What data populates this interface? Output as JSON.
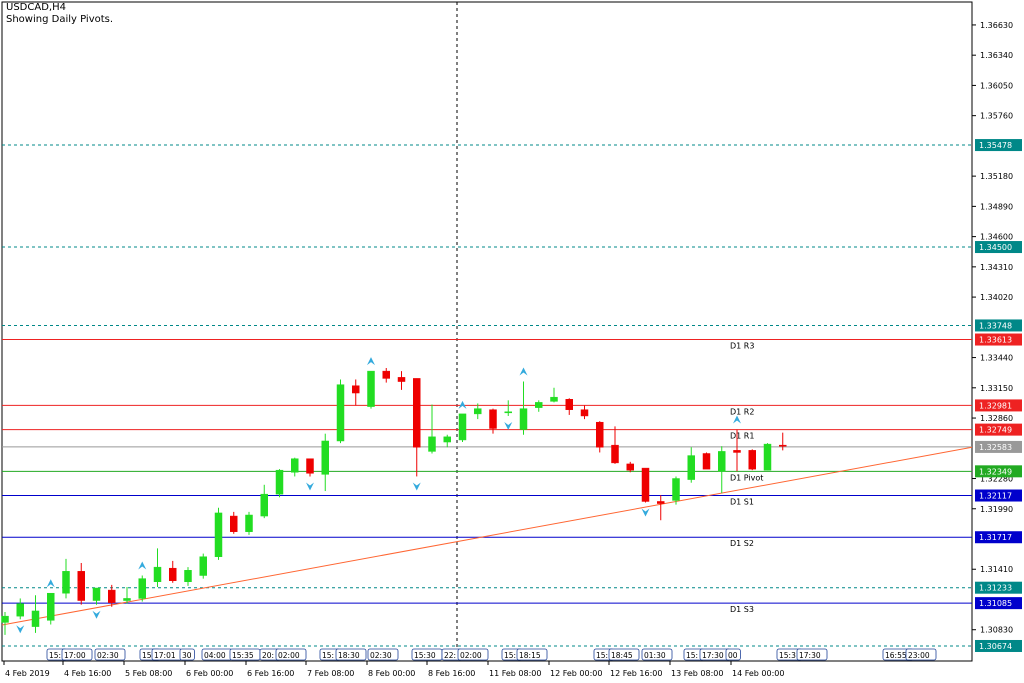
{
  "window": {
    "symbol_timeframe": "USDCAD,H4",
    "indicator_note": "Showing Daily Pivots."
  },
  "colors": {
    "bull": "#22dd22",
    "bear": "#ee0000",
    "resistance": "#ee2222",
    "support": "#0000cc",
    "pivot": "#22aa22",
    "trendline": "#ff6633",
    "dotted_level": "#008888",
    "price_tag": "#999999",
    "arrow": "#33aadd",
    "axis": "#000000"
  },
  "chart_data": {
    "type": "candlestick",
    "ylim": [
      1.3053,
      1.3685
    ],
    "price_ticks": [
      1.3663,
      1.3634,
      1.3605,
      1.3576,
      1.3518,
      1.3489,
      1.346,
      1.3431,
      1.3402,
      1.3344,
      1.3315,
      1.3286,
      1.3228,
      1.3199,
      1.3141,
      1.3083
    ],
    "levels": [
      {
        "name": "D1 R3",
        "price": 1.33613,
        "kind": "resistance",
        "tag": "1.33613"
      },
      {
        "name": "D1 R2",
        "price": 1.32981,
        "kind": "resistance",
        "tag": "1.32981"
      },
      {
        "name": "D1 R1",
        "price": 1.32749,
        "kind": "resistance",
        "tag": "1.32749"
      },
      {
        "name": "D1 Pivot",
        "price": 1.32349,
        "kind": "pivot",
        "tag": "1.32349"
      },
      {
        "name": "D1 S1",
        "price": 1.32117,
        "kind": "support",
        "tag": "1.32117"
      },
      {
        "name": "D1 S2",
        "price": 1.31717,
        "kind": "support",
        "tag": "1.31717"
      },
      {
        "name": "D1 S3",
        "price": 1.31085,
        "kind": "support",
        "tag": "1.31085"
      }
    ],
    "dotted_levels": [
      {
        "price": 1.35478,
        "tag": "1.35478"
      },
      {
        "price": 1.345,
        "tag": "1.34500"
      },
      {
        "price": 1.33748,
        "tag": "1.33748"
      },
      {
        "price": 1.31233,
        "tag": "1.31233"
      },
      {
        "price": 1.30674,
        "tag": "1.30674"
      }
    ],
    "current_price": {
      "price": 1.32583,
      "tag": "1.32583"
    },
    "time_labels": [
      "4 Feb 2019",
      "4 Feb 16:00",
      "5 Feb 08:00",
      "6 Feb 00:00",
      "6 Feb 16:00",
      "7 Feb 08:00",
      "8 Feb 00:00",
      "8 Feb 16:00",
      "11 Feb 08:00",
      "12 Feb 00:00",
      "12 Feb 16:00",
      "13 Feb 08:00",
      "14 Feb 00:00"
    ],
    "session_tags": [
      "15:",
      "17:00",
      "02:30",
      "15:",
      "17:01",
      "30",
      "04:00",
      "15:35",
      "20:",
      "02:00",
      "15:",
      "18:30",
      "02:30",
      "15:30",
      "22:",
      "02:00",
      "15:",
      "18:15",
      "15:",
      "18:45",
      "01:30",
      "15:",
      "17:30",
      "00",
      "15:3",
      "17:30",
      "16:55",
      "23:00"
    ],
    "candles": [
      {
        "o": 1.309,
        "h": 1.31,
        "l": 1.3078,
        "c": 1.3096
      },
      {
        "o": 1.3096,
        "h": 1.3113,
        "l": 1.3093,
        "c": 1.3108
      },
      {
        "o": 1.3086,
        "h": 1.3116,
        "l": 1.308,
        "c": 1.3101
      },
      {
        "o": 1.3092,
        "h": 1.3118,
        "l": 1.3088,
        "c": 1.3118
      },
      {
        "o": 1.3118,
        "h": 1.3151,
        "l": 1.3113,
        "c": 1.3139
      },
      {
        "o": 1.3139,
        "h": 1.3147,
        "l": 1.3107,
        "c": 1.3111
      },
      {
        "o": 1.3111,
        "h": 1.3123,
        "l": 1.3107,
        "c": 1.3123
      },
      {
        "o": 1.3121,
        "h": 1.3126,
        "l": 1.3105,
        "c": 1.3109
      },
      {
        "o": 1.3111,
        "h": 1.3124,
        "l": 1.3108,
        "c": 1.3113
      },
      {
        "o": 1.3113,
        "h": 1.3135,
        "l": 1.311,
        "c": 1.3132
      },
      {
        "o": 1.3129,
        "h": 1.3161,
        "l": 1.3124,
        "c": 1.3143
      },
      {
        "o": 1.3142,
        "h": 1.3149,
        "l": 1.3128,
        "c": 1.313
      },
      {
        "o": 1.3129,
        "h": 1.3143,
        "l": 1.3125,
        "c": 1.314
      },
      {
        "o": 1.3135,
        "h": 1.3156,
        "l": 1.3132,
        "c": 1.3153
      },
      {
        "o": 1.3153,
        "h": 1.32,
        "l": 1.315,
        "c": 1.3195
      },
      {
        "o": 1.3192,
        "h": 1.3196,
        "l": 1.3175,
        "c": 1.3177
      },
      {
        "o": 1.3177,
        "h": 1.3196,
        "l": 1.3174,
        "c": 1.3193
      },
      {
        "o": 1.3192,
        "h": 1.3222,
        "l": 1.319,
        "c": 1.3213
      },
      {
        "o": 1.3213,
        "h": 1.3237,
        "l": 1.321,
        "c": 1.3236
      },
      {
        "o": 1.3234,
        "h": 1.3248,
        "l": 1.323,
        "c": 1.3247
      },
      {
        "o": 1.3247,
        "h": 1.3246,
        "l": 1.323,
        "c": 1.3233
      },
      {
        "o": 1.3232,
        "h": 1.3271,
        "l": 1.3216,
        "c": 1.3264
      },
      {
        "o": 1.3264,
        "h": 1.3323,
        "l": 1.3262,
        "c": 1.3318
      },
      {
        "o": 1.3317,
        "h": 1.3323,
        "l": 1.3298,
        "c": 1.331
      },
      {
        "o": 1.3297,
        "h": 1.3331,
        "l": 1.3295,
        "c": 1.3331
      },
      {
        "o": 1.3331,
        "h": 1.3334,
        "l": 1.332,
        "c": 1.3324
      },
      {
        "o": 1.3325,
        "h": 1.3331,
        "l": 1.3313,
        "c": 1.3321
      },
      {
        "o": 1.3324,
        "h": 1.3324,
        "l": 1.323,
        "c": 1.3258
      },
      {
        "o": 1.3254,
        "h": 1.3299,
        "l": 1.3252,
        "c": 1.3268
      },
      {
        "o": 1.3263,
        "h": 1.327,
        "l": 1.3258,
        "c": 1.3268
      },
      {
        "o": 1.3265,
        "h": 1.3289,
        "l": 1.3263,
        "c": 1.329
      },
      {
        "o": 1.329,
        "h": 1.33,
        "l": 1.3285,
        "c": 1.3295
      },
      {
        "o": 1.3294,
        "h": 1.3295,
        "l": 1.3271,
        "c": 1.3276
      },
      {
        "o": 1.3291,
        "h": 1.3303,
        "l": 1.3288,
        "c": 1.3292
      },
      {
        "o": 1.3275,
        "h": 1.3321,
        "l": 1.327,
        "c": 1.3295
      },
      {
        "o": 1.3296,
        "h": 1.3303,
        "l": 1.3292,
        "c": 1.3301
      },
      {
        "o": 1.3302,
        "h": 1.3315,
        "l": 1.3301,
        "c": 1.3306
      },
      {
        "o": 1.3304,
        "h": 1.3305,
        "l": 1.3289,
        "c": 1.3294
      },
      {
        "o": 1.3294,
        "h": 1.3298,
        "l": 1.3285,
        "c": 1.3288
      },
      {
        "o": 1.3282,
        "h": 1.3283,
        "l": 1.3253,
        "c": 1.3258
      },
      {
        "o": 1.326,
        "h": 1.3278,
        "l": 1.3242,
        "c": 1.3243
      },
      {
        "o": 1.3242,
        "h": 1.3244,
        "l": 1.3234,
        "c": 1.3236
      },
      {
        "o": 1.3238,
        "h": 1.3235,
        "l": 1.3205,
        "c": 1.3206
      },
      {
        "o": 1.3206,
        "h": 1.3212,
        "l": 1.3188,
        "c": 1.3204
      },
      {
        "o": 1.3207,
        "h": 1.323,
        "l": 1.3203,
        "c": 1.3228
      },
      {
        "o": 1.3227,
        "h": 1.3258,
        "l": 1.3224,
        "c": 1.325
      },
      {
        "o": 1.3252,
        "h": 1.3253,
        "l": 1.3241,
        "c": 1.3237
      },
      {
        "o": 1.3235,
        "h": 1.3259,
        "l": 1.3214,
        "c": 1.3254
      },
      {
        "o": 1.3255,
        "h": 1.3275,
        "l": 1.3235,
        "c": 1.3253
      },
      {
        "o": 1.3255,
        "h": 1.3256,
        "l": 1.3236,
        "c": 1.3237
      },
      {
        "o": 1.3236,
        "h": 1.3262,
        "l": 1.3236,
        "c": 1.3261
      },
      {
        "o": 1.326,
        "h": 1.3272,
        "l": 1.3255,
        "c": 1.3259
      }
    ],
    "arrows": [
      {
        "candle": 1,
        "dir": "down"
      },
      {
        "candle": 3,
        "dir": "up"
      },
      {
        "candle": 6,
        "dir": "down"
      },
      {
        "candle": 9,
        "dir": "up"
      },
      {
        "candle": 20,
        "dir": "down"
      },
      {
        "candle": 24,
        "dir": "up"
      },
      {
        "candle": 27,
        "dir": "down"
      },
      {
        "candle": 30,
        "dir": "up"
      },
      {
        "candle": 33,
        "dir": "down"
      },
      {
        "candle": 34,
        "dir": "up"
      },
      {
        "candle": 42,
        "dir": "down"
      },
      {
        "candle": 48,
        "dir": "up"
      }
    ],
    "trendline": [
      [
        1.30875,
        1.3258
      ]
    ],
    "vertical_marker_time": "8 Feb 16:00"
  }
}
